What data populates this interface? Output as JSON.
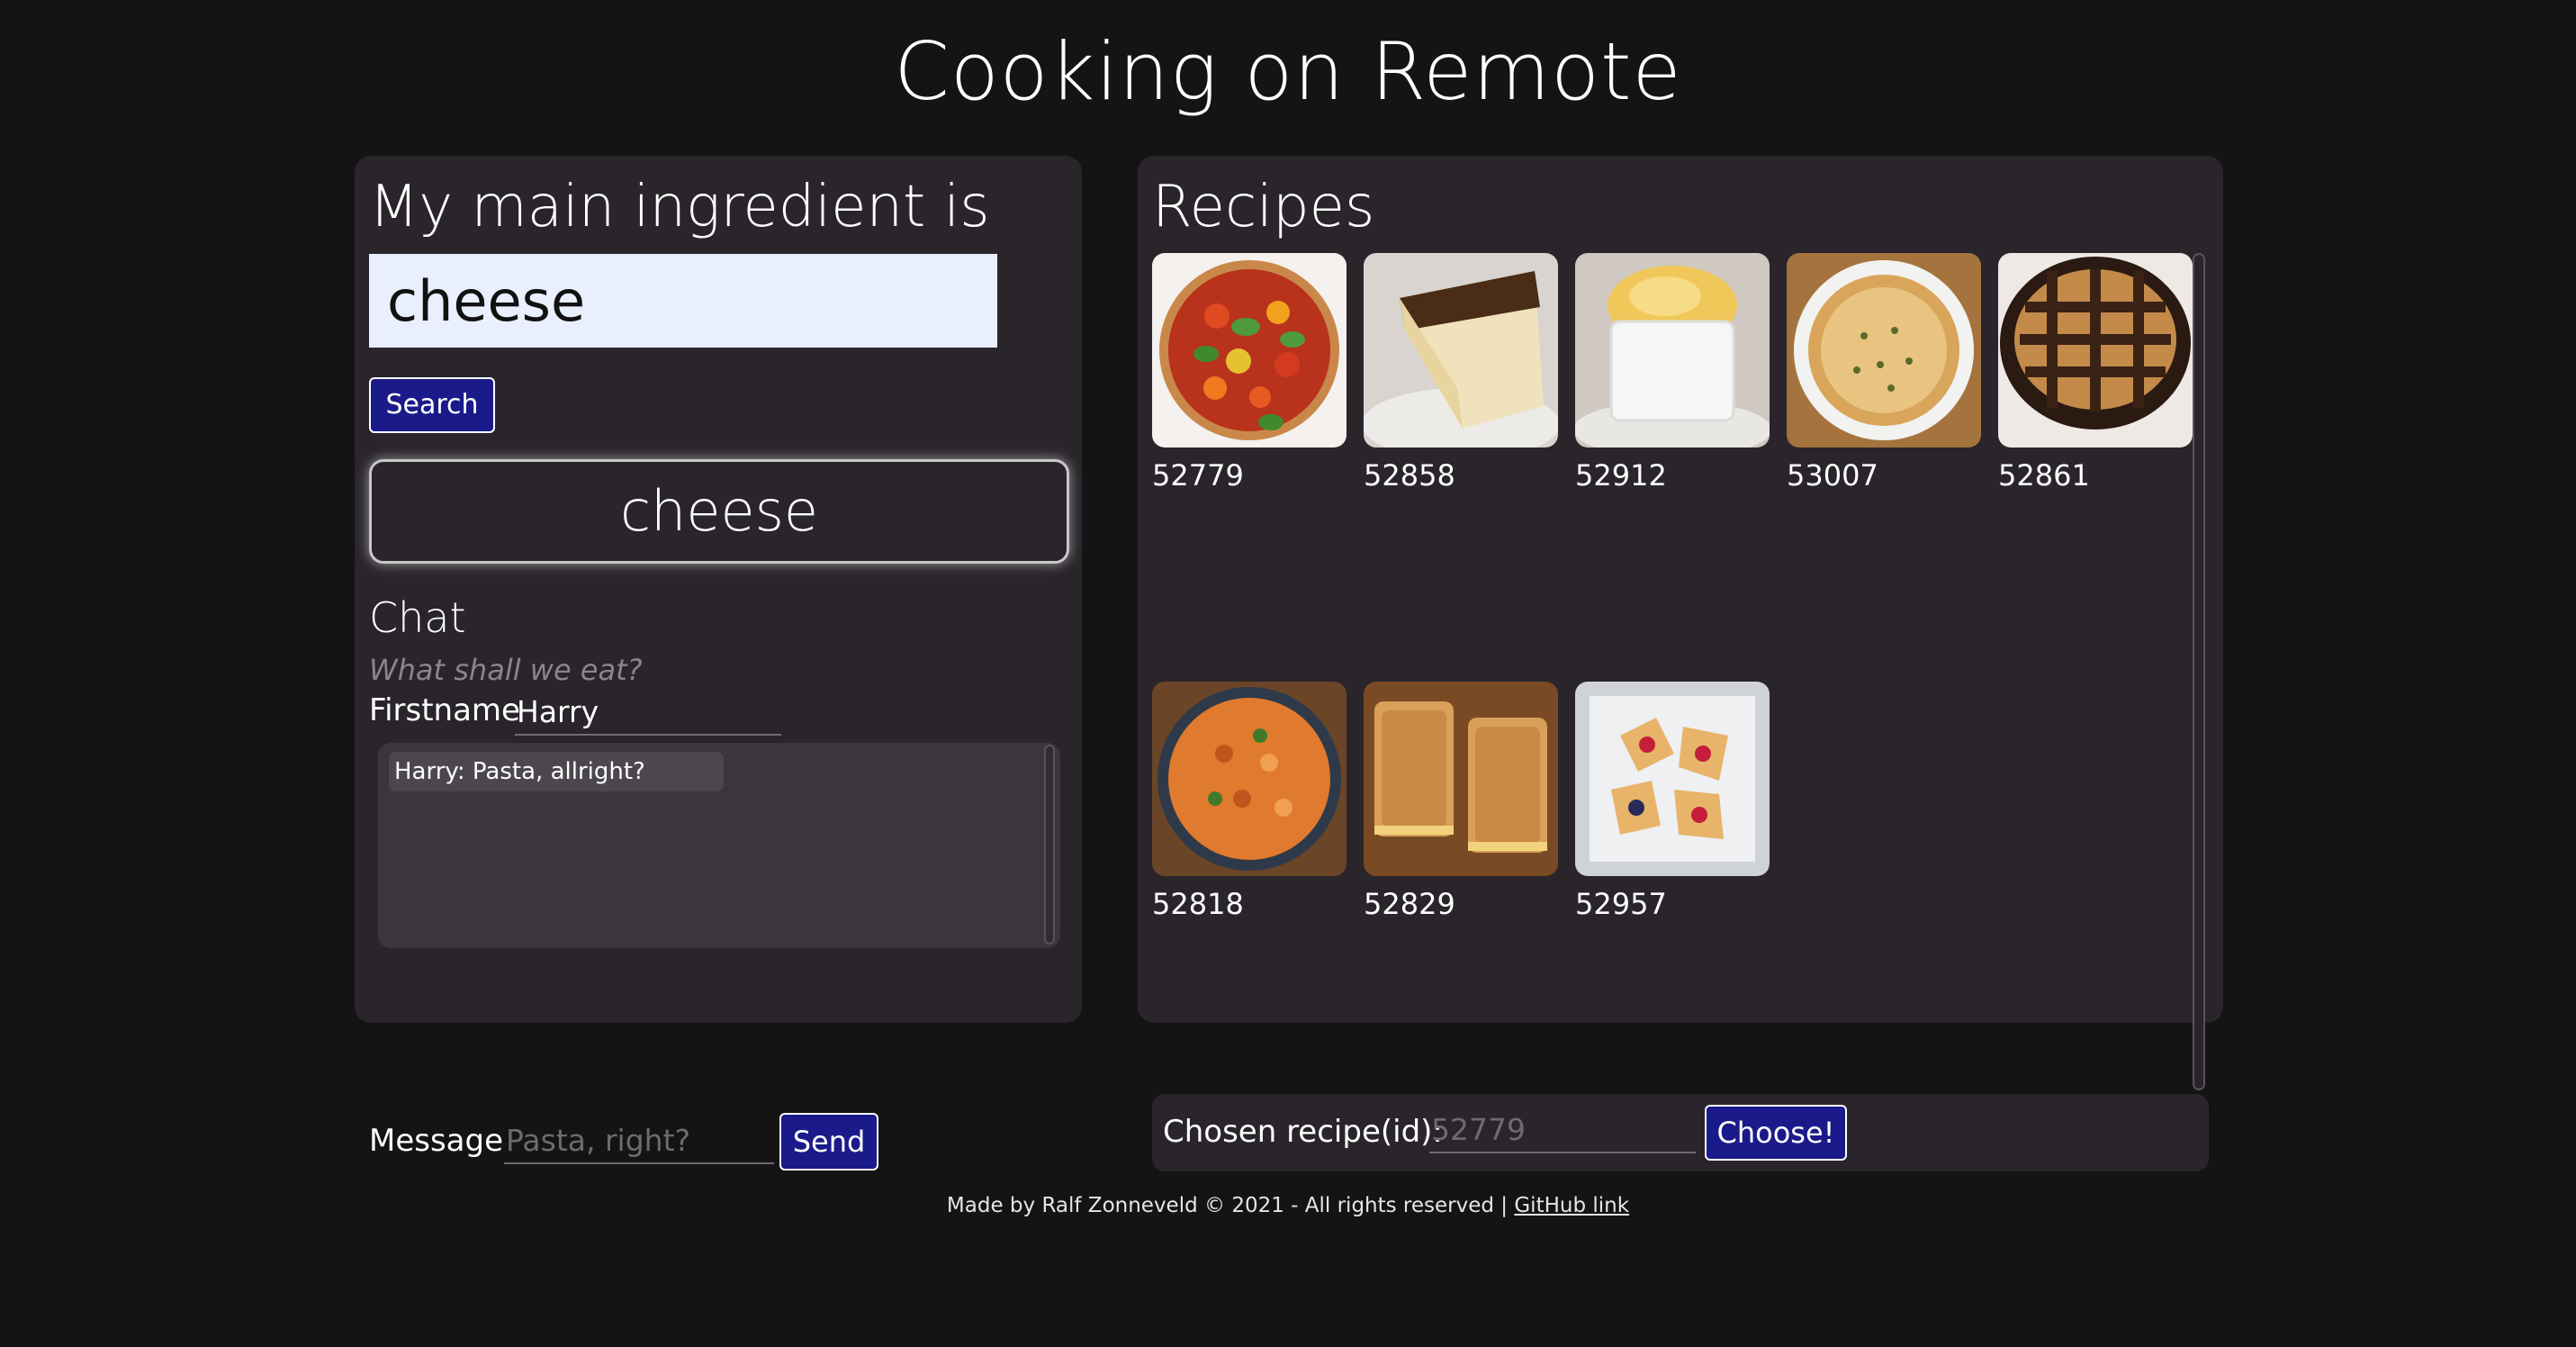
{
  "page": {
    "title": "Cooking on Remote"
  },
  "ingredient": {
    "heading": "My main ingredient is",
    "input_value": "cheese",
    "search_label": "Search",
    "selected": "cheese"
  },
  "chat": {
    "heading": "Chat",
    "hint": "What shall we eat?",
    "firstname_label": "Firstname",
    "firstname_value": "Harry",
    "messages": [
      "Harry: Pasta, allright?"
    ],
    "message_label": "Message",
    "message_placeholder": "Pasta, right?",
    "send_label": "Send"
  },
  "recipes": {
    "heading": "Recipes",
    "items": [
      {
        "id": "52779",
        "image": "tomato-tart"
      },
      {
        "id": "52858",
        "image": "cheesecake-slice"
      },
      {
        "id": "52912",
        "image": "souffle"
      },
      {
        "id": "53007",
        "image": "quiche"
      },
      {
        "id": "52861",
        "image": "chocolate-tart"
      },
      {
        "id": "52818",
        "image": "pasta-dish"
      },
      {
        "id": "52829",
        "image": "grilled-cheese"
      },
      {
        "id": "52957",
        "image": "berry-pastries"
      }
    ]
  },
  "chosen": {
    "label": "Chosen recipe(id):",
    "placeholder": "52779",
    "choose_label": "Choose!"
  },
  "footer": {
    "text": "Made by Ralf Zonneveld © 2021 - All rights reserved |",
    "link_label": "GitHub link"
  }
}
